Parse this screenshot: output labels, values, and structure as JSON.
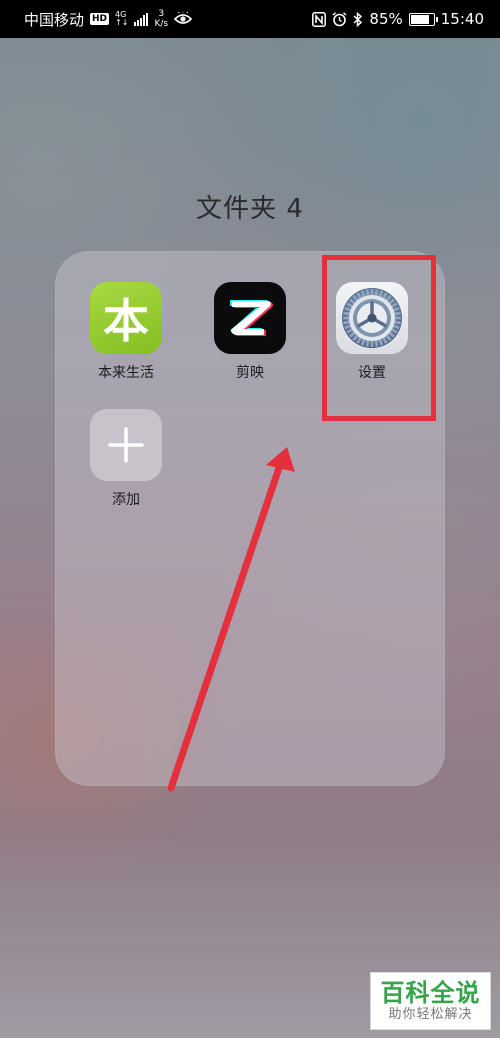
{
  "status_bar": {
    "carrier": "中国移动",
    "hd": "HD",
    "network_top": "4G",
    "network_bottom": "↑↓",
    "speed_value": "3",
    "speed_unit": "K/s",
    "battery_percent": "85%",
    "battery_level": 0.85,
    "time": "15:40",
    "icons": [
      "nfc-icon",
      "alarm-icon",
      "bluetooth-icon",
      "eye-icon"
    ]
  },
  "folder": {
    "title": "文件夹 4",
    "apps": [
      {
        "label": "本来生活",
        "icon": "benlai-app-icon",
        "icon_text": "本",
        "color": "#8cc63f"
      },
      {
        "label": "剪映",
        "icon": "jianying-app-icon",
        "color": "#0b0b0d"
      },
      {
        "label": "设置",
        "icon": "settings-gear-icon",
        "color": "#5a6f8c"
      },
      {
        "label": "添加",
        "icon": "add-plus-icon"
      }
    ]
  },
  "annotation": {
    "highlight_color": "#e4303c"
  },
  "watermark": {
    "main": "百科全说",
    "sub": "助你轻松解决",
    "color": "#37a34a"
  }
}
